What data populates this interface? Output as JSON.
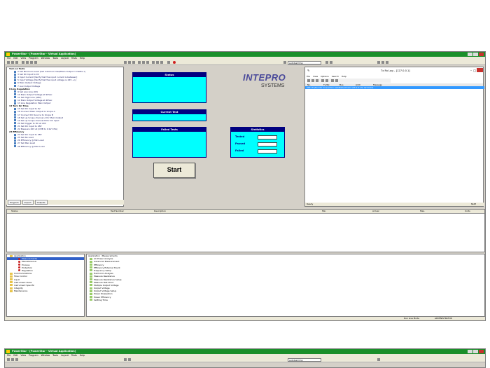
{
  "window": {
    "title": "PowerStar - [PowerStar - Virtual Application]",
    "colors": {
      "title_bar": "#1a8f2a",
      "panel_fill": "#00ffff",
      "panel_header": "#000080",
      "selection": "#3399ff"
    }
  },
  "menu": [
    "File",
    "Edit",
    "View",
    "Program",
    "Window",
    "Tools",
    "Layout",
    "Tests",
    "Help"
  ],
  "toolbar": {
    "combo_value": "autotest.tmp"
  },
  "test_tree": {
    "items": [
      {
        "label": "Turn on Tests",
        "group": true
      },
      {
        "label": "2 Set Minimum Load (Set minimum load/Main Output = Define I)"
      },
      {
        "label": "3 Set DC Input to 0V"
      },
      {
        "label": "4 Input Current [Verify that the input current is between]"
      },
      {
        "label": "5 Input Voltage [Verify that the input voltage is 24V +/-]"
      },
      {
        "label": "6 Main Output Voltage"
      },
      {
        "label": "7 Aux Output Voltage"
      },
      {
        "label": "8 Line Regulation",
        "group": true
      },
      {
        "label": "9 Set Low Line (0V)"
      },
      {
        "label": "10 Main Output Voltage at 90Vac"
      },
      {
        "label": "11 Set High Line (48V)"
      },
      {
        "label": "12 Main Output Voltage at 48Vac"
      },
      {
        "label": "13 Line Regulation Main Output"
      },
      {
        "label": "14 Turn On Time",
        "group": true
      },
      {
        "label": "15 Set DC Input to 0V"
      },
      {
        "label": "16 Connect Main Output to Scope A"
      },
      {
        "label": "17 Connect DC Source to Scope B"
      },
      {
        "label": "18 Set up Scope channel A for Main Output"
      },
      {
        "label": "19 Set up Scope channel B for DC input"
      },
      {
        "label": "20 Set trigger to DC at 20V"
      },
      {
        "label": "21 Set DC Input to 28V"
      },
      {
        "label": "22 Measure 20V at (CHB to 0.9V CHA)"
      },
      {
        "label": "23 Efficiency",
        "group": true
      },
      {
        "label": "24 Set DC Input to 28V"
      },
      {
        "label": "25 Set No Load"
      },
      {
        "label": "26 Efficiency @ Min Load"
      },
      {
        "label": "27 Set Max Load"
      },
      {
        "label": "28 Efficiency @ Max Load"
      }
    ],
    "tabs": [
      "Program",
      "Import",
      "Outputs"
    ]
  },
  "panels": {
    "status": "Status",
    "current_test": "Current Test",
    "failed_tests": "Failed Tests",
    "statistics": "Statistics",
    "tested": "Tested",
    "passed": "Passed",
    "failed": "Failed",
    "start": "Start"
  },
  "logo": {
    "line1": "INTEPRO",
    "line2": "SYSTEMS"
  },
  "log": {
    "title": "Tx Rx Log – [127.0.0.1]",
    "menu": [
      "File",
      "View",
      "Options",
      "Search",
      "Help"
    ],
    "columns": [
      "No.",
      "Tx/Rx",
      "Bus",
      "Addr",
      "Message"
    ],
    "selected_row": "0001 Tx/Rx:Info Connection established from 127.0.0.1 to 127.0.0.1",
    "status_left": "Ready",
    "status_right": "NUM"
  },
  "results": {
    "columns": [
      "Status",
      "Test Number",
      "Description",
      "Min.",
      "Actual",
      "Max.",
      "Units"
    ]
  },
  "browser": {
    "left": [
      {
        "label": "Application",
        "kind": "folder"
      },
      {
        "label": "Measurements",
        "kind": "red",
        "selected": true
      },
      {
        "label": "Miscellaneous",
        "kind": "red"
      },
      {
        "label": "Process",
        "kind": "red"
      },
      {
        "label": "Protection",
        "kind": "red"
      },
      {
        "label": "Regulation",
        "kind": "red"
      },
      {
        "label": "Communications",
        "kind": "folder"
      },
      {
        "label": "Flow Control",
        "kind": "folder"
      },
      {
        "label": "Input",
        "kind": "folder"
      },
      {
        "label": "Instrument Class",
        "kind": "folder"
      },
      {
        "label": "Instrument Specific",
        "kind": "folder"
      },
      {
        "label": "Integrity",
        "kind": "folder"
      },
      {
        "label": "Maintenance",
        "kind": "folder"
      }
    ],
    "right_header": "Application : Measurements",
    "right": [
      "AC Power Analysis",
      "Advanced Measurement",
      "Efficiency",
      "Efficiency External Shunt",
      "Frequency Setup",
      "Harmonic Analysis",
      "Measure Resistance",
      "Measure Resistance Setup",
      "Measure Test Point",
      "Multiple Output Voltage",
      "Output Voltage",
      "Output Voltage Setup",
      "Power Dissipation",
      "Power Efficiency",
      "Settling Time"
    ]
  },
  "statusbar": {
    "mode": "Run Live Mode",
    "user": "ADMINISTRATOR"
  }
}
